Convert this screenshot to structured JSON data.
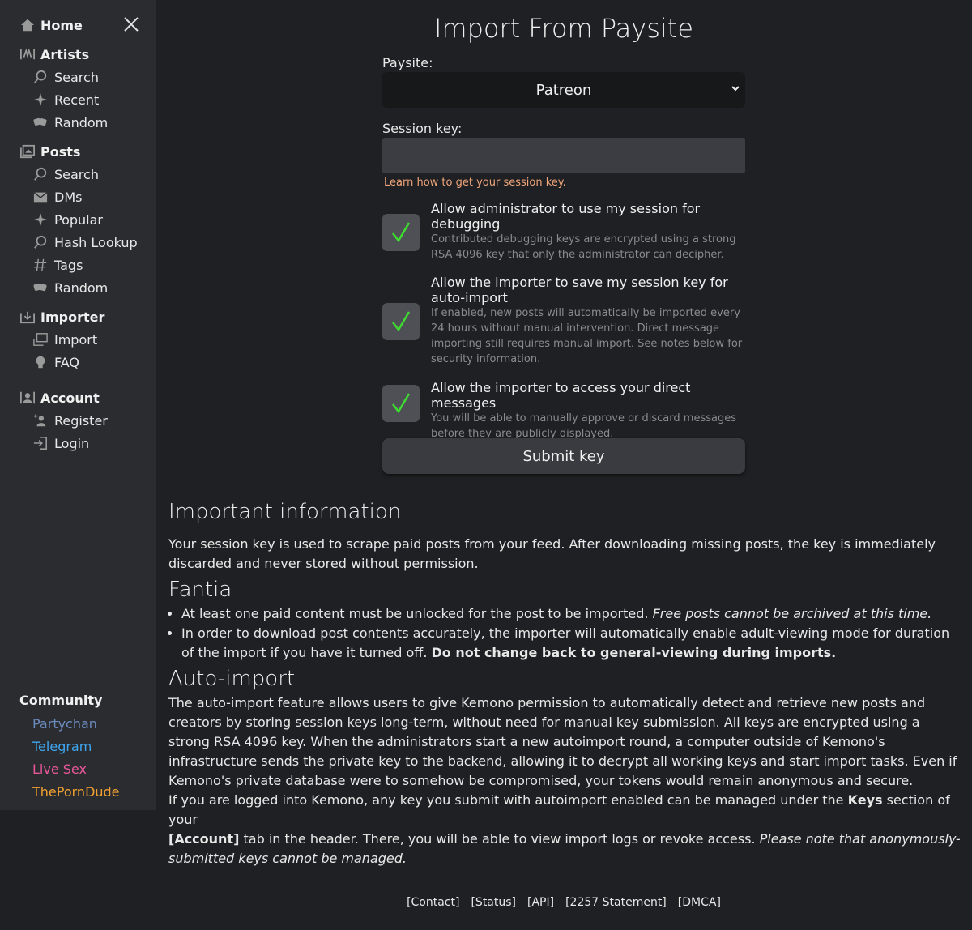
{
  "sidebar": {
    "home": "Home",
    "artists": {
      "title": "Artists",
      "items": [
        {
          "label": "Search",
          "icon": "search-icon"
        },
        {
          "label": "Recent",
          "icon": "sparkle-icon"
        },
        {
          "label": "Random",
          "icon": "dice-icon"
        }
      ]
    },
    "posts": {
      "title": "Posts",
      "items": [
        {
          "label": "Search",
          "icon": "search-icon"
        },
        {
          "label": "DMs",
          "icon": "envelope-icon"
        },
        {
          "label": "Popular",
          "icon": "sparkle-icon"
        },
        {
          "label": "Hash Lookup",
          "icon": "search-icon"
        },
        {
          "label": "Tags",
          "icon": "hash-icon"
        },
        {
          "label": "Random",
          "icon": "dice-icon"
        }
      ]
    },
    "importer": {
      "title": "Importer",
      "items": [
        {
          "label": "Import",
          "icon": "import-icon"
        },
        {
          "label": "FAQ",
          "icon": "faq-icon"
        }
      ]
    },
    "account": {
      "title": "Account",
      "items": [
        {
          "label": "Register",
          "icon": "register-icon"
        },
        {
          "label": "Login",
          "icon": "login-icon"
        }
      ]
    },
    "community": {
      "title": "Community",
      "links": [
        {
          "label": "Partychan",
          "color": "#6b8bbf"
        },
        {
          "label": "Telegram",
          "color": "#3fa6f0"
        },
        {
          "label": "Live Sex",
          "color": "#e8589a"
        },
        {
          "label": "ThePornDude",
          "color": "#f0a030"
        }
      ]
    }
  },
  "page": {
    "title": "Import From Paysite",
    "paysite_label": "Paysite:",
    "paysite_value": "Patreon",
    "session_label": "Session key:",
    "session_value": "",
    "learn_link": "Learn how to get your session key.",
    "checks": [
      {
        "title": "Allow administrator to use my session for debugging",
        "desc": "Contributed debugging keys are encrypted using a strong RSA 4096 key that only the administrator can decipher.",
        "checked": true
      },
      {
        "title": "Allow the importer to save my session key for auto-import",
        "desc": "If enabled, new posts will automatically be imported every 24 hours without manual intervention. Direct message importing still requires manual import. See notes below for security information.",
        "checked": true
      },
      {
        "title": "Allow the importer to access your direct messages",
        "desc": "You will be able to manually approve or discard messages before they are publicly displayed.",
        "checked": true
      }
    ],
    "submit": "Submit key"
  },
  "info": {
    "heading": "Important information",
    "intro": "Your session key is used to scrape paid posts from your feed. After downloading missing posts, the key is immediately discarded and never stored without permission.",
    "fantia_heading": "Fantia",
    "fantia_b1_text": "At least one paid content must be unlocked for the post to be imported.",
    "fantia_b1_em": "Free posts cannot be archived at this time.",
    "fantia_b2_text": "In order to download post contents accurately, the importer will automatically enable adult-viewing mode for duration of the import if you have it turned off.",
    "fantia_b2_strong": "Do not change back to general-viewing during imports.",
    "auto_heading": "Auto-import",
    "auto_p1": "The auto-import feature allows users to give Kemono permission to automatically detect and retrieve new posts and creators by storing session keys long-term, without need for manual key submission. All keys are encrypted using a strong RSA 4096 key. When the administrators start a new autoimport round, a computer outside of Kemono's infrastructure sends the private key to the backend, allowing it to decrypt all working keys and start import tasks. Even if Kemono's private database were to somehow be compromised, your tokens would remain anonymous and secure.",
    "auto_p2_a": "If you are logged into Kemono, any key you submit with autoimport enabled can be managed under the",
    "auto_p2_keys": "Keys",
    "auto_p2_b": "section of your",
    "auto_p2_account": "[Account]",
    "auto_p2_c": "tab in the header. There, you will be able to view import logs or revoke access.",
    "auto_p2_em": "Please note that anonymously-submitted keys cannot be managed."
  },
  "footer": {
    "links": [
      "[Contact]",
      "[Status]",
      "[API]",
      "[2257 Statement]",
      "[DMCA]"
    ]
  },
  "colors": {
    "background": "#1f2023",
    "sidebar": "#2b2c30",
    "check": "#3ddc2f",
    "learn_link": "#f0a57a"
  }
}
